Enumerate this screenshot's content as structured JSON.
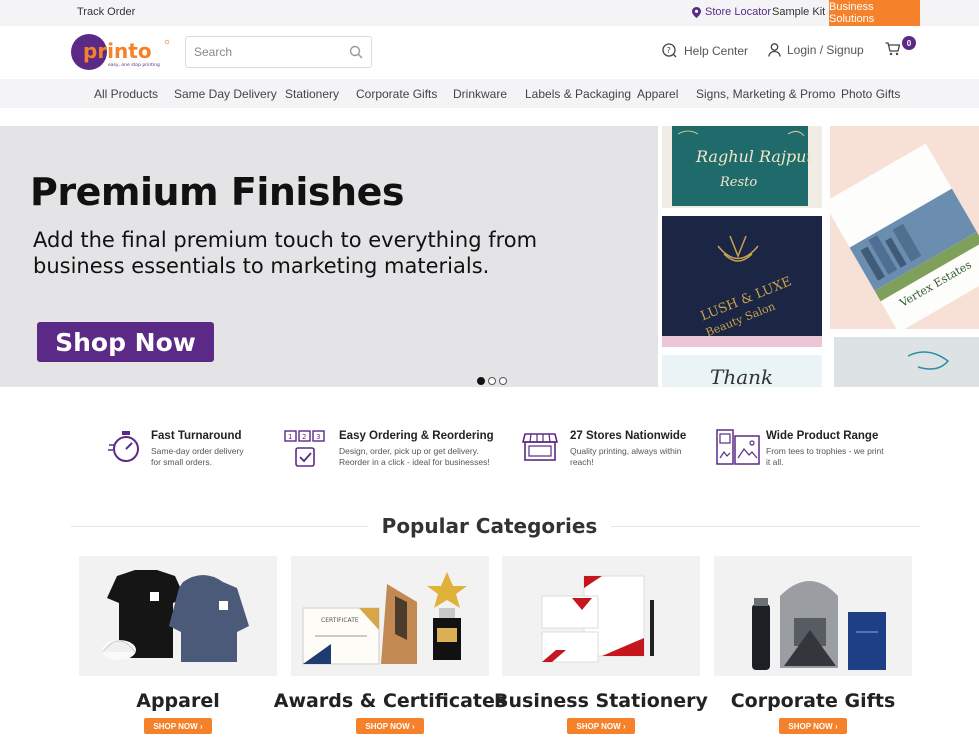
{
  "topbar": {
    "track_order": "Track Order",
    "store_locator": "Store Locator",
    "sample_kit": "Sample Kit",
    "business_solutions": "Business Solutions"
  },
  "header": {
    "logo_text": "printo",
    "logo_tagline": "easy, one stop printing",
    "search_placeholder": "Search",
    "help_center": "Help Center",
    "login": "Login / Signup",
    "cart_count": "0"
  },
  "nav": {
    "items": [
      "All Products",
      "Same Day Delivery",
      "Stationery",
      "Corporate Gifts",
      "Drinkware",
      "Labels & Packaging",
      "Apparel",
      "Signs, Marketing & Promo",
      "Photo Gifts"
    ]
  },
  "hero": {
    "title": "Premium Finishes",
    "subtitle": "Add the final premium touch to everything from business essentials to marketing materials.",
    "cta": "Shop Now",
    "card_invite_line1": "Raghul Rajput",
    "card_invite_line2": "Resto",
    "card_lush_line1": "LUSH & LUXE",
    "card_lush_line2": "Beauty Salon",
    "card_vertex": "Vertex Estates",
    "card_thank": "Thank"
  },
  "features": [
    {
      "title": "Fast Turnaround",
      "desc_line1": "Same-day order delivery",
      "desc_line2": "for small orders.",
      "icon": "stopwatch-icon"
    },
    {
      "title": "Easy Ordering & Reordering",
      "desc_line1": "Design, order, pick up or get delivery.",
      "desc_line2": "Reorder in a click - ideal for businesses!",
      "icon": "steps-checklist-icon"
    },
    {
      "title": "27 Stores Nationwide",
      "desc_line1": "Quality printing, always within",
      "desc_line2": "reach!",
      "icon": "storefront-icon"
    },
    {
      "title": "Wide Product Range",
      "desc_line1": "From tees to trophies - we print",
      "desc_line2": "it all.",
      "icon": "product-range-icon"
    }
  ],
  "popular": {
    "title": "Popular Categories",
    "categories": [
      {
        "name": "Apparel",
        "cta": "SHOP NOW"
      },
      {
        "name": "Awards & Certificates",
        "cta": "SHOP NOW"
      },
      {
        "name": "Business Stationery",
        "cta": "SHOP NOW"
      },
      {
        "name": "Corporate Gifts",
        "cta": "SHOP NOW"
      }
    ],
    "certificate_label": "CERTIFICATE"
  },
  "colors": {
    "brand_purple": "#5b2a86",
    "brand_orange": "#f5822a",
    "hero_grey": "#e4e4e6"
  }
}
